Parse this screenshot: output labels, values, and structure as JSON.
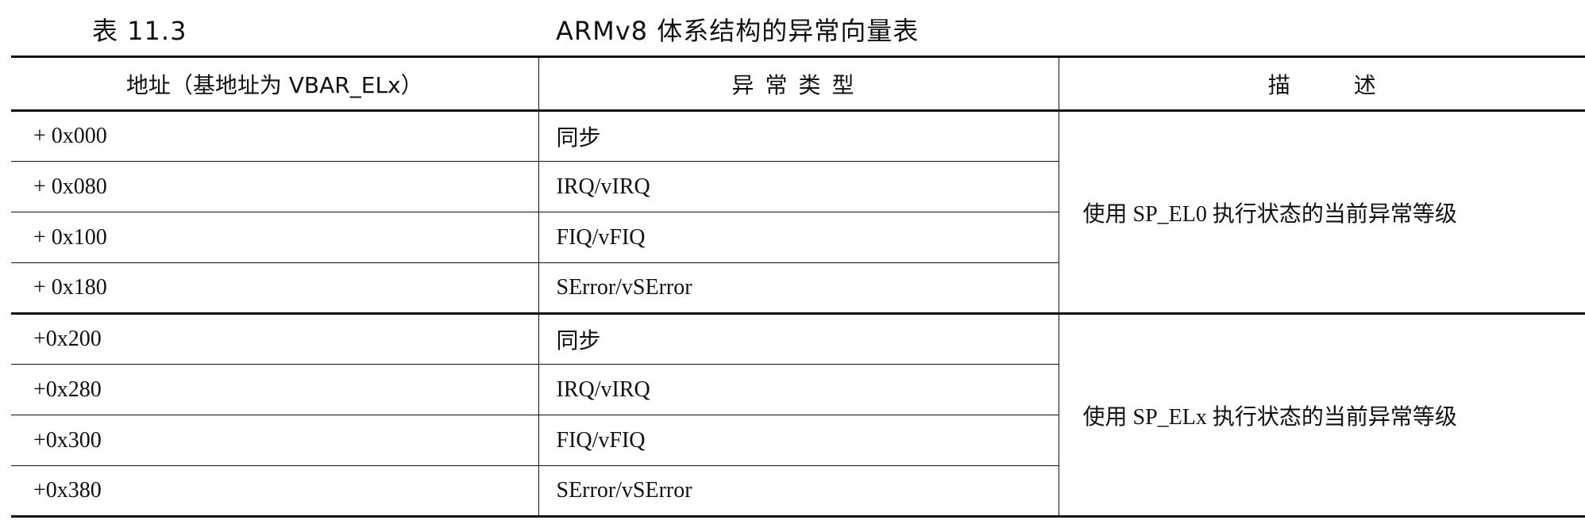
{
  "caption": {
    "label": "表 11.3",
    "title": "ARMv8 体系结构的异常向量表"
  },
  "headers": {
    "address": "地址（基地址为 VBAR_ELx）",
    "type": "异常类型",
    "description": "描述"
  },
  "groups": [
    {
      "description": "使用 SP_EL0 执行状态的当前异常等级",
      "rows": [
        {
          "address": "+ 0x000",
          "type": "同步"
        },
        {
          "address": "+ 0x080",
          "type": "IRQ/vIRQ"
        },
        {
          "address": "+ 0x100",
          "type": "FIQ/vFIQ"
        },
        {
          "address": "+ 0x180",
          "type": "SError/vSError"
        }
      ]
    },
    {
      "description": "使用 SP_ELx 执行状态的当前异常等级",
      "rows": [
        {
          "address": "+0x200",
          "type": "同步"
        },
        {
          "address": "+0x280",
          "type": "IRQ/vIRQ"
        },
        {
          "address": "+0x300",
          "type": "FIQ/vFIQ"
        },
        {
          "address": "+0x380",
          "type": "SError/vSError"
        }
      ]
    }
  ]
}
